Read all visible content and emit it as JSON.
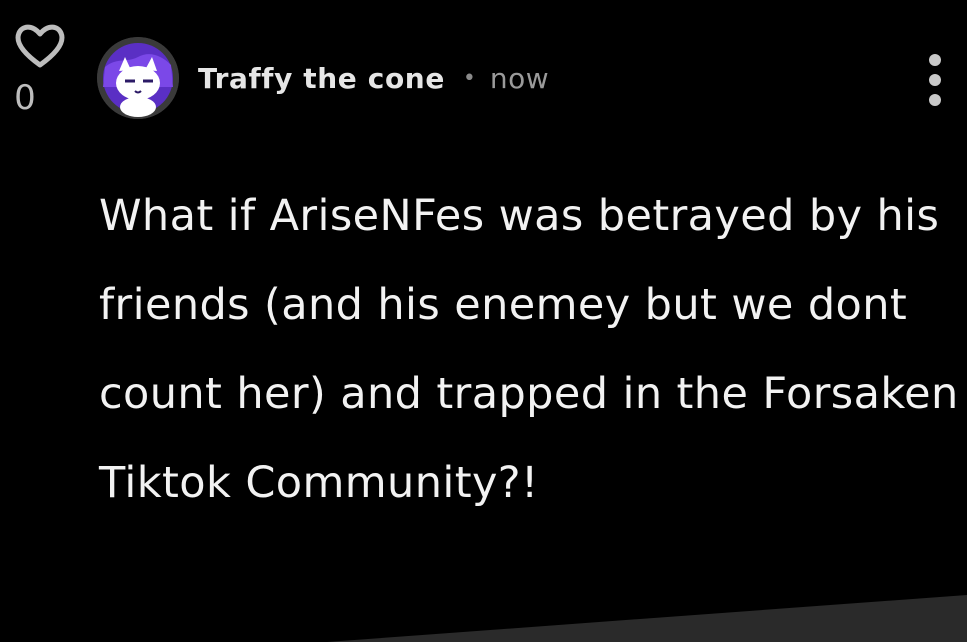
{
  "post": {
    "like_count": "0",
    "author": "Traffy the cone",
    "separator": "•",
    "time": "now",
    "body": "What if AriseNFes was betrayed by his friends (and his enemey but we dont count her) and trapped in the Forsaken Tiktok Community?!"
  },
  "icons": {
    "like": "heart-icon",
    "menu": "more-vertical-icon",
    "avatar": "cat-avatar"
  },
  "colors": {
    "background": "#000000",
    "text": "#f2f2f2",
    "muted": "#9a9a9a",
    "avatar_accent": "#6a2bd1"
  }
}
